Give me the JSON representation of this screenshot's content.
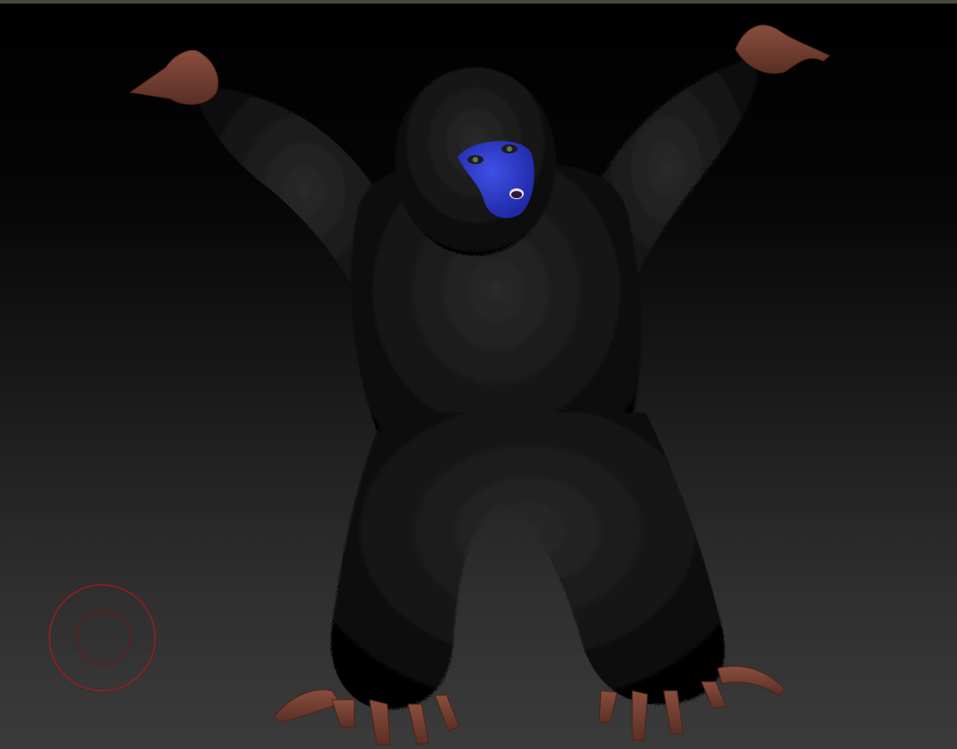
{
  "viewport": {
    "background": [
      "#000000",
      "#3b3b3b"
    ],
    "frame_color": "#4a463f"
  },
  "model": {
    "subject": "furry-gorilla-sculpt",
    "fur_color": "#161616",
    "face_color": "#2b36c9",
    "skin_color": "#6a3a2e"
  },
  "brush_cursor": {
    "outer_color": "#b01818",
    "inner_color": "#7a1010"
  }
}
